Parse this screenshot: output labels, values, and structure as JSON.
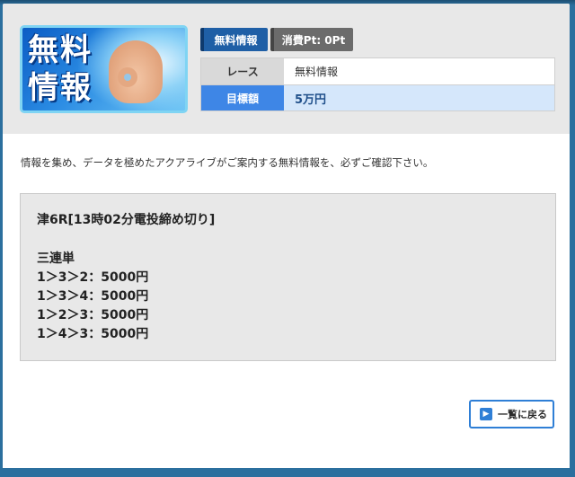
{
  "header": {
    "thumbnail": {
      "text_line1": "無料",
      "text_line2": "情報"
    },
    "badges": {
      "free": "無料情報",
      "points": "消費Pt: 0Pt"
    },
    "info": {
      "race_label": "レース",
      "race_value": "無料情報",
      "target_label": "目標額",
      "target_value": "5万円"
    }
  },
  "lead_text": "情報を集め、データを極めたアクアライブがご案内する無料情報を、必ずご確認下さい。",
  "content": {
    "race_title": "津6R[13時02分電投締め切り]",
    "bet_type": "三連単",
    "bets": [
      "1＞3＞2：5000円",
      "1＞3＞4：5000円",
      "1＞2＞3：5000円",
      "1＞4＞3：5000円"
    ]
  },
  "back_button": {
    "label": "一覧に戻る"
  },
  "colors": {
    "frame": "#2b6f9e",
    "accent_blue": "#3e86e6",
    "badge_free": "#1f5fa6",
    "badge_points": "#6b6b6b",
    "target_value_bg": "#d5e7fb"
  }
}
